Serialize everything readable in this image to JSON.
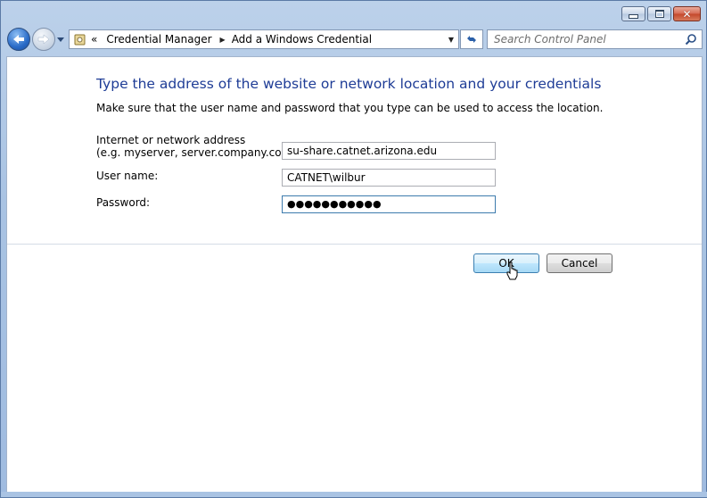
{
  "window": {
    "caption_buttons": [
      {
        "name": "minimize",
        "icon": "minimize-icon"
      },
      {
        "name": "maximize",
        "icon": "maximize-icon"
      },
      {
        "name": "close",
        "icon": "close-icon"
      }
    ]
  },
  "nav": {
    "back_icon": "back-arrow-icon",
    "forward_icon": "forward-arrow-icon",
    "history_dropdown_icon": "chevron-down-icon"
  },
  "address_bar": {
    "overflow_chevron": "«",
    "breadcrumbs": [
      {
        "label": "Credential Manager"
      },
      {
        "label": "Add a Windows Credential"
      }
    ],
    "location_icon": "control-panel-icon",
    "dropdown_icon": "chevron-down-icon"
  },
  "refresh": {
    "icon": "refresh-icon"
  },
  "search": {
    "placeholder": "Search Control Panel",
    "icon": "search-icon"
  },
  "form": {
    "heading": "Type the address of the website or network location and your credentials",
    "instructions": "Make sure that the user name and password that you type can be used to access the location.",
    "address_label_line1": "Internet or network address",
    "address_label_line2": "(e.g. myserver, server.company.com):",
    "address_value": "su-share.catnet.arizona.edu",
    "username_label": "User name:",
    "username_value": "CATNET\\wilbur",
    "password_label": "Password:",
    "password_masked": "●●●●●●●●●●●"
  },
  "buttons": {
    "ok_label": "OK",
    "cancel_label": "Cancel"
  },
  "colors": {
    "heading": "#1e3c96",
    "ok_border": "#3c7fb1"
  }
}
